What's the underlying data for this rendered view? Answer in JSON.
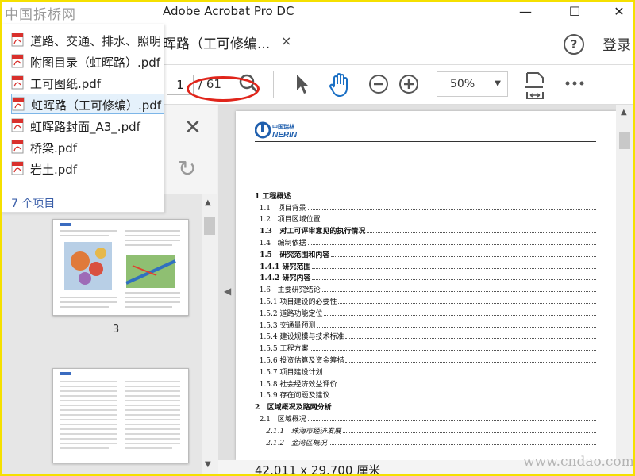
{
  "app_title": "Adobe Acrobat Pro DC",
  "watermark_top": "中国拆桥网",
  "watermark_bottom": "www.cndao.com",
  "window_controls": [
    "—",
    "☐",
    "✕"
  ],
  "tab": {
    "label": "晖路（工可修编...",
    "close": "×"
  },
  "header_right": {
    "help": "?",
    "login": "登录"
  },
  "toolbar": {
    "page_current": "1",
    "page_total": "/ 61",
    "zoom": "50%"
  },
  "file_list": {
    "items": [
      "道路、交通、排水、照明",
      "附图目录（虹晖路）.pdf",
      "工可图纸.pdf",
      "虹晖路（工可修编）.pdf",
      "虹晖路封面_A3_.pdf",
      "桥梁.pdf",
      "岩土.pdf"
    ],
    "selected_index": 3,
    "count_label": "7 个项目"
  },
  "sidebar": {
    "thumb_page_label": "3"
  },
  "document": {
    "logo_cn": "中国瑞林",
    "logo_en": "NERIN",
    "toc": [
      {
        "text": "1 工程概述",
        "style": "b"
      },
      {
        "text": "  1.1   项目背景",
        "style": ""
      },
      {
        "text": "  1.2   项目区域位置",
        "style": ""
      },
      {
        "text": "  1.3   对工可评审意见的执行情况",
        "style": "b"
      },
      {
        "text": "  1.4   编制依据",
        "style": ""
      },
      {
        "text": "  1.5   研究范围和内容",
        "style": "b"
      },
      {
        "text": "  1.4.1 研究范围",
        "style": "b"
      },
      {
        "text": "  1.4.2 研究内容",
        "style": "b"
      },
      {
        "text": "  1.6   主要研究结论",
        "style": ""
      },
      {
        "text": "  1.5.1 项目建设的必要性",
        "style": ""
      },
      {
        "text": "  1.5.2 道路功能定位",
        "style": ""
      },
      {
        "text": "  1.5.3 交通量预测",
        "style": ""
      },
      {
        "text": "  1.5.4 建设规模与技术标准",
        "style": ""
      },
      {
        "text": "  1.5.5 工程方案",
        "style": ""
      },
      {
        "text": "  1.5.6 投资估算及资金筹措",
        "style": ""
      },
      {
        "text": "  1.5.7 项目建设计划",
        "style": ""
      },
      {
        "text": "  1.5.8 社会经济效益评价",
        "style": ""
      },
      {
        "text": "  1.5.9 存在问题及建议",
        "style": ""
      },
      {
        "text": "2   区域概况及路网分析",
        "style": "b"
      },
      {
        "text": "  2.1   区域概况",
        "style": ""
      },
      {
        "text": "     2.1.1   珠海市经济发展",
        "style": "i"
      },
      {
        "text": "     2.1.2   金湾区概况",
        "style": "i"
      }
    ]
  },
  "status": {
    "dimensions": "42.011 x 29.700 厘米"
  },
  "colors": {
    "selection": "#e5f1fb",
    "annotation": "#e0251b",
    "border": "#f5e000"
  }
}
